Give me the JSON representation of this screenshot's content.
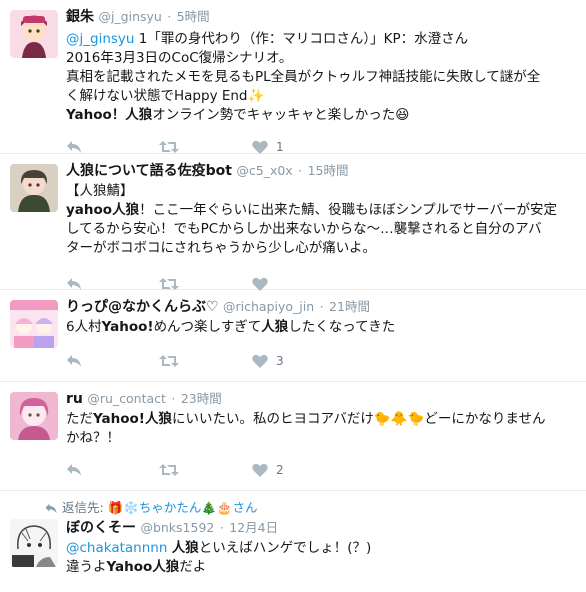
{
  "tweets": [
    {
      "name": "銀朱",
      "handle": "@j_ginsyu",
      "time": "5時間",
      "lines": [
        {
          "mention": "@j_ginsyu",
          "rest": " 1「罪の身代わり（作：マリコロさん）」KP：水澄さん"
        },
        {
          "text": "2016年3月3日のCoC復帰シナリオ。"
        },
        {
          "text": "真相を記載されたメモを見るもPL全員がクトゥルフ神話技能に失敗して謎が全"
        },
        {
          "text": "く解けない状態でHappy End✨"
        },
        {
          "bold": "Yahoo！人狼",
          "rest": "オンライン勢でキャッキャと楽しかった😆"
        }
      ],
      "like_count": "1",
      "avatar_colors": [
        "#f3d7e6",
        "#b83b63",
        "#ffd6a8"
      ]
    },
    {
      "name": "人狼について語る佐疫bot",
      "handle": "@c5_x0x",
      "time": "15時間",
      "lines": [
        {
          "text": "【人狼鯖】"
        },
        {
          "bold": "yahoo人狼",
          "rest": "！ここ一年ぐらいに出来た鯖、役職もほぼシンプルでサーバーが安定"
        },
        {
          "text": "してるから安心！でもPCからしか出来ないからな〜…襲撃されると自分のアバ"
        },
        {
          "text": "ターがボコボコにされちゃうから少し心が痛いよ。"
        }
      ],
      "like_count": "",
      "avatar_colors": [
        "#3d3d3d",
        "#6b7a5b",
        "#e8d2c4"
      ]
    },
    {
      "name": "りっぴ@なかくんらぶ♡",
      "handle": "@richapiyo_jin",
      "time": "21時間",
      "lines": [
        {
          "text": "6人村",
          "bold": "Yahoo!",
          "rest": "めんつ楽しすぎて",
          "bold2": "人狼",
          "rest2": "したくなってきた"
        }
      ],
      "like_count": "3",
      "avatar_colors": [
        "#fbd5e5",
        "#e86aa0",
        "#f8f0ff"
      ]
    },
    {
      "name": "ru",
      "handle": "@ru_contact",
      "time": "23時間",
      "lines": [
        {
          "text": "ただ",
          "bold": "Yahoo!人狼",
          "rest": "にいいたい。私のヒヨコアバだけ🐤🐥🐤どーにかなりません"
        },
        {
          "text": "かね？！"
        }
      ],
      "like_count": "2",
      "avatar_colors": [
        "#e58fb5",
        "#f6c9dc",
        "#b85384"
      ]
    },
    {
      "reply_to_label": "返信先:",
      "reply_to_name": "🎁❄️ちゃかたん🎄🎂さん",
      "name": "ぼのくそー",
      "handle": "@bnks1592",
      "time": "12月4日",
      "lines": [
        {
          "mention": "@chakatannnn",
          "rest": " ",
          "bold": "人狼",
          "rest2": "といえばハンゲでしょ！(？)"
        },
        {
          "text": "違うよ",
          "bold": "Yahoo人狼",
          "rest": "だよ"
        }
      ],
      "like_count": "",
      "avatar_colors": [
        "#ffffff",
        "#555555",
        "#cccccc"
      ]
    }
  ],
  "icons": {
    "reply": "reply-icon",
    "retweet": "retweet-icon",
    "like": "heart-icon",
    "reply_to": "reply-arrow-icon"
  }
}
